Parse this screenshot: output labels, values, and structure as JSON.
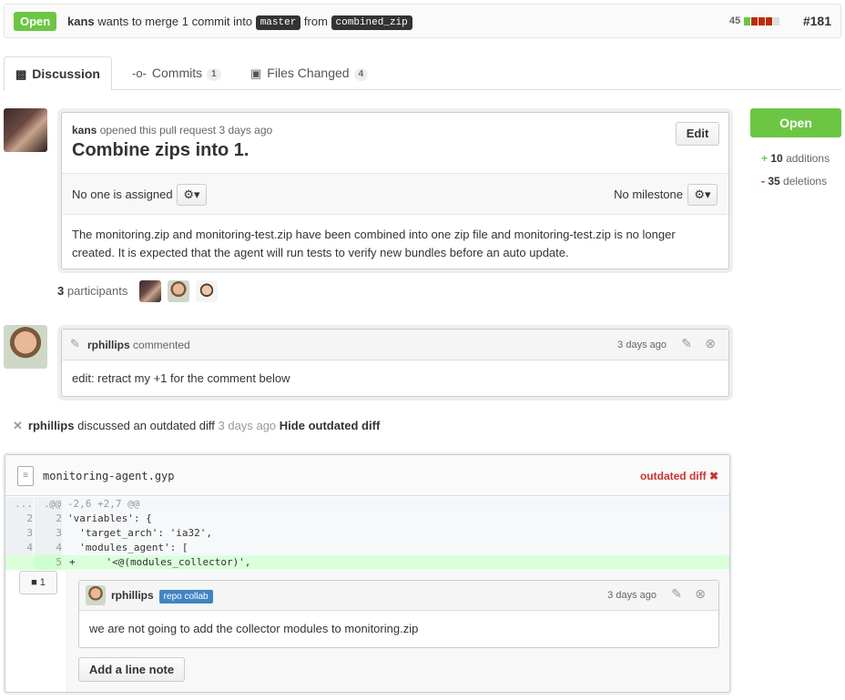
{
  "header": {
    "state": "Open",
    "author": "kans",
    "merge_text": "wants to merge 1 commit into",
    "base_branch": "master",
    "from_text": "from",
    "head_branch": "combined_zip",
    "diffstat_count": "45",
    "pr_number": "#181",
    "colors": {
      "open_green": "#6cc644",
      "add_green": "#6cc644",
      "del_red": "#bd2c00"
    }
  },
  "tabs": [
    {
      "label": "Discussion",
      "icon": "discussion-icon",
      "count": ""
    },
    {
      "label": "Commits",
      "icon": "commit-icon",
      "count": "1"
    },
    {
      "label": "Files Changed",
      "icon": "diff-file-icon",
      "count": "4"
    }
  ],
  "pr": {
    "author": "kans",
    "opened_text": "opened this pull request 3 days ago",
    "title": "Combine zips into 1.",
    "edit_label": "Edit",
    "assignee_text": "No one is assigned",
    "milestone_text": "No milestone",
    "body": "The monitoring.zip and monitoring-test.zip have been combined into one zip file and monitoring-test.zip is no longer created. It is expected that the agent will run tests to verify new bundles before an auto update."
  },
  "participants": {
    "count": "3",
    "label": "participants"
  },
  "comment": {
    "author": "rphillips",
    "action": "commented",
    "time": "3 days ago",
    "body": "edit: retract my +1 for the comment below"
  },
  "outdated": {
    "author": "rphillips",
    "text": "discussed an outdated diff",
    "time": "3 days ago",
    "hide_label": "Hide outdated diff",
    "file_name": "monitoring-agent.gyp",
    "outdated_label": "outdated diff",
    "diff_lines": [
      {
        "type": "hunk",
        "n1": "...",
        "n2": "...",
        "code": "@@ -2,6 +2,7 @@"
      },
      {
        "type": "ctx",
        "n1": "2",
        "n2": "2",
        "code": "'variables': {"
      },
      {
        "type": "ctx",
        "n1": "3",
        "n2": "3",
        "code": "  'target_arch': 'ia32',"
      },
      {
        "type": "ctx",
        "n1": "4",
        "n2": "4",
        "code": "  'modules_agent': ["
      },
      {
        "type": "add",
        "n1": "",
        "n2": "5",
        "code": "    '<@(modules_collector)',"
      }
    ],
    "note_count": "1",
    "note": {
      "author": "rphillips",
      "badge": "repo collab",
      "time": "3 days ago",
      "body": "we are not going to add the collector modules to monitoring.zip"
    },
    "add_note_label": "Add a line note"
  },
  "sidebar": {
    "state_label": "Open",
    "additions_count": "10",
    "additions_label": "additions",
    "deletions_count": "35",
    "deletions_label": "deletions"
  }
}
